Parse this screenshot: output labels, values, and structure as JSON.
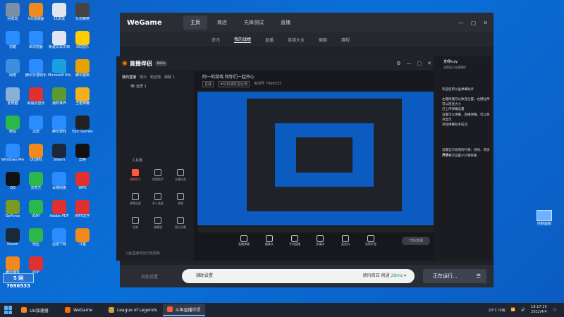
{
  "desktop_icons": [
    {
      "label": "回收站",
      "color": "#7a8fa8"
    },
    {
      "label": "UU加速器",
      "color": "#f08a1c"
    },
    {
      "label": "11调试",
      "color": "#dfe6f0"
    },
    {
      "label": "反恐精英",
      "color": "#444"
    },
    {
      "label": "优酷",
      "color": "#2a8cff"
    },
    {
      "label": "IE浏览器",
      "color": "#2a8cff"
    },
    {
      "label": "新建文本文档",
      "color": "#dfe6f0"
    },
    {
      "label": "QQ音乐",
      "color": "#ffcc00"
    },
    {
      "label": "网络",
      "color": "#3c8fe0"
    },
    {
      "label": "腾讯手游助手",
      "color": "#2a8cff"
    },
    {
      "label": "Microsoft Edge",
      "color": "#1aa0e0"
    },
    {
      "label": "腾讯视频",
      "color": "#e6a200"
    },
    {
      "label": "此电脑",
      "color": "#8ab0d8"
    },
    {
      "label": "网易云音乐",
      "color": "#e03030"
    },
    {
      "label": "我的世界",
      "color": "#5a9a30"
    },
    {
      "label": "王者荣耀",
      "color": "#f0b020"
    },
    {
      "label": "微信",
      "color": "#2bb84a"
    },
    {
      "label": "迅雷",
      "color": "#2a8cff"
    },
    {
      "label": "腾讯游戏",
      "color": "#2a8cff"
    },
    {
      "label": "Epic Games",
      "color": "#222"
    },
    {
      "label": "Windows Media",
      "color": "#2a8cff"
    },
    {
      "label": "QQ游戏",
      "color": "#f08a1c"
    },
    {
      "label": "Steam",
      "color": "#1b2838"
    },
    {
      "label": "剪映",
      "color": "#111"
    },
    {
      "label": "QQ",
      "color": "#111"
    },
    {
      "label": "爱奇艺",
      "color": "#2bb84a"
    },
    {
      "label": "百度网盘",
      "color": "#2a8cff"
    },
    {
      "label": "WPS",
      "color": "#e03030"
    },
    {
      "label": "GeForce",
      "color": "#7a9a20"
    },
    {
      "label": "iQIYI",
      "color": "#2bb84a"
    },
    {
      "label": "Adobe PDF",
      "color": "#e03030"
    },
    {
      "label": "WPS文字",
      "color": "#e03030"
    },
    {
      "label": "Steam",
      "color": "#1b2838"
    },
    {
      "label": "快压",
      "color": "#2bb84a"
    },
    {
      "label": "迅雷下载",
      "color": "#2a8cff"
    },
    {
      "label": "斗鱼",
      "color": "#f08a1c"
    },
    {
      "label": "腾讯课堂",
      "color": "#f08a1c"
    },
    {
      "label": "PDF",
      "color": "#e03030"
    }
  ],
  "right_icon": {
    "label": "控制面板"
  },
  "stamp": {
    "logo": "5 网",
    "number": "7696533"
  },
  "wegame": {
    "logo": "WeGame",
    "tabs": [
      "主页",
      "商店",
      "先锋测试",
      "直播"
    ],
    "active_tab": 0,
    "subnav": [
      "资讯",
      "我的战绩",
      "直播",
      "英雄大全",
      "聊聊",
      "赛程"
    ],
    "active_sub": 1,
    "bottom_left": "其他设置",
    "assist": "辅助设置",
    "server": "德玛西亚 网通",
    "ping": "29ms",
    "running": "正在运行..."
  },
  "stream_app": {
    "logo": "直播伴侣",
    "version": "beta",
    "tabs": [
      "我的直播",
      "观众",
      "粉丝墙",
      "弹幕 1"
    ],
    "active_tab": 0,
    "scene_label": "全屏 1",
    "tools_label": "工具箱",
    "tools": [
      {
        "label": "弹幕助手",
        "hot": true
      },
      {
        "label": "房管助手",
        "hot": false
      },
      {
        "label": "主播任务",
        "hot": false
      },
      {
        "label": "视频连麦",
        "hot": false
      },
      {
        "label": "多人连麦",
        "hot": false
      },
      {
        "label": "录屏",
        "hot": false
      },
      {
        "label": "礼物",
        "hot": false
      },
      {
        "label": "弹幕墙",
        "hot": false
      },
      {
        "label": "音乐点歌",
        "hot": false
      }
    ],
    "notice": "斗鱼直播伴侣已经更新",
    "room_title": "阿一的游戏 和你们一起开心",
    "room_meta": [
      "直播",
      "#我英雄联盟比赛"
    ],
    "room_id": "房间号 7696533",
    "controls": [
      "直播弹幕",
      "摄像头",
      "手机直播",
      "多媒体",
      "麦克风",
      "话筒声音"
    ],
    "start_label": "开始直播"
  },
  "chat": {
    "user": "发呀kuiy",
    "sub": "这是显示在直播间",
    "lines": [
      "欢迎您用斗鱼弹幕助手",
      "左键拖拽可以改变位置，右键拉伸可以改变大小",
      "已上传弹幕设置",
      "设置可以弹幕，直播弹幕，可以移开显示",
      "添加弹幕助手成功",
      "设置显示收到的礼物、进场、贵族开通",
      "点屏幕可设置小礼物屏蔽"
    ]
  },
  "taskbar": {
    "items": [
      {
        "label": "UU加速器",
        "color": "#f08a1c",
        "active": false
      },
      {
        "label": "WeGame",
        "color": "#ff6a00",
        "active": false
      },
      {
        "label": "League of Legends",
        "color": "#c8a050",
        "active": false
      },
      {
        "label": "斗鱼直播伴侣",
        "color": "#ff5a3c",
        "active": true
      }
    ],
    "weather": "20°C 中雨",
    "time": "18:17:10",
    "date": "2022/4/4"
  }
}
